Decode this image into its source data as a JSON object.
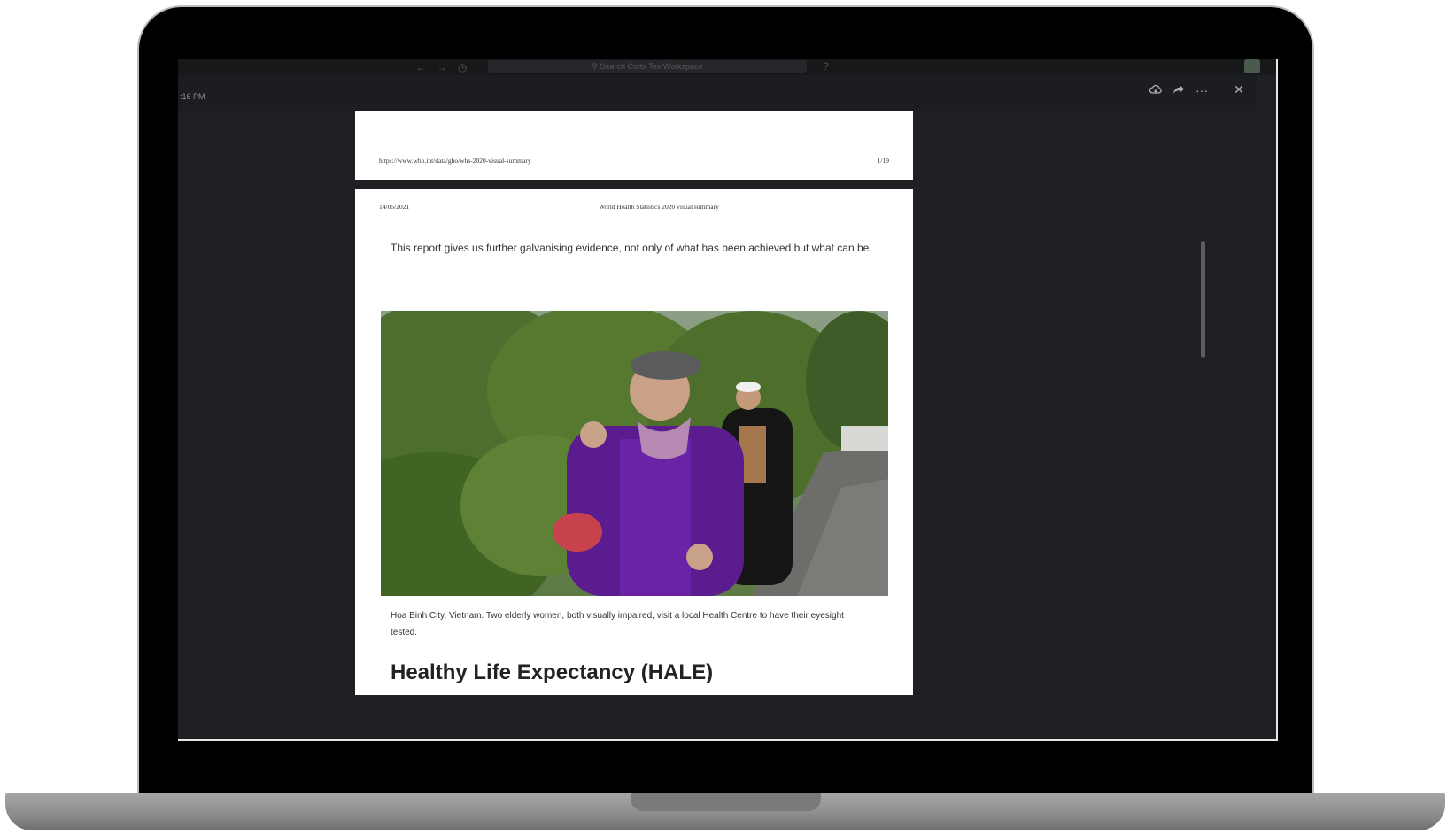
{
  "app_toolbar": {
    "search_placeholder": "Search Cortx Tex Workspace"
  },
  "viewer": {
    "time": ":16 PM",
    "actions": {
      "download_icon": "download-cloud-icon",
      "share_icon": "share-icon",
      "more_icon": "more-icon",
      "close_icon": "close-icon"
    }
  },
  "document": {
    "page1": {
      "footer_url": "https://www.who.int/data/gho/whs-2020-visual-summary",
      "page_number": "1/19"
    },
    "page2": {
      "date": "14/05/2021",
      "header_title": "World Health Statistics 2020 visual summary",
      "intro_text": "This report gives us further galvanising evidence, not only of what has been achieved but what can be.",
      "photo_caption": "Hoa Binh City, Vietnam. Two elderly women, both visually impaired, visit a local Health Centre to have their eyesight tested.",
      "section_heading": "Healthy Life Expectancy (HALE)"
    }
  }
}
